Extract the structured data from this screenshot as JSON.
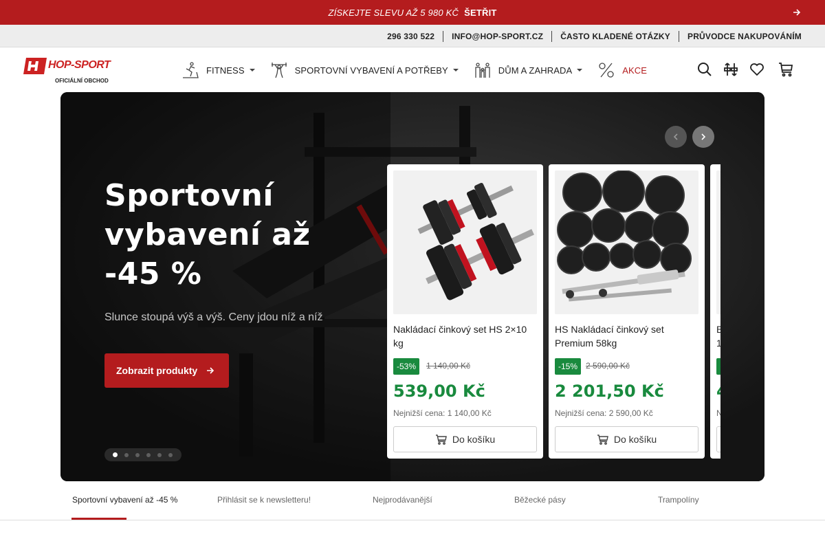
{
  "promo": {
    "text": "ZÍSKEJTE SLEVU AŽ 5 980 KČ",
    "cta": "ŠETŘIT",
    "arrow_icon": "arrow-right-icon"
  },
  "utility": {
    "phone": "296 330 522",
    "email": "INFO@HOP-SPORT.CZ",
    "faq": "ČASTO KLADENÉ OTÁZKY",
    "guide": "PRŮVODCE NAKUPOVÁNÍM"
  },
  "logo": {
    "brand": "HOP-SPORT",
    "subtitle": "OFICIÁLNÍ OBCHOD"
  },
  "nav": [
    {
      "label": "FITNESS",
      "icon": "treadmill-icon"
    },
    {
      "label": "SPORTOVNÍ VYBAVENÍ A POTŘEBY",
      "icon": "weightlifter-icon"
    },
    {
      "label": "DŮM A ZAHRADA",
      "icon": "family-icon"
    },
    {
      "label": "AKCE",
      "icon": "percent-icon"
    }
  ],
  "header_icons": [
    "search-icon",
    "compare-icon",
    "heart-icon",
    "cart-icon"
  ],
  "hero": {
    "title_line1": "Sportovní",
    "title_line2": "vybavení až",
    "title_line3": "-45 %",
    "lead": "Slunce stoupá výš a výš. Ceny jdou níž a níž",
    "button": "Zobrazit produkty",
    "slide_count": 6,
    "active_slide": 1
  },
  "products": [
    {
      "name": "Nakládací činkový set HS 2×10 kg",
      "discount": "-53%",
      "old_price": "1 140,00 Kč",
      "price": "539,00 Kč",
      "lowest": "Nejnižší cena: 1 140,00 Kč",
      "button": "Do košíku"
    },
    {
      "name": "HS Nakládací činkový set Premium 58kg",
      "discount": "-15%",
      "old_price": "2 590,00 Kč",
      "price": "2 201,50 Kč",
      "lowest": "Nejnižší cena: 2 590,00 Kč",
      "button": "Do košíku"
    },
    {
      "name": "B",
      "name2": "1",
      "price_fragment": "4",
      "lowest_fragment": "N"
    }
  ],
  "tabs": [
    "Sportovní vybavení až -45 %",
    "Přihlásit se k newsletteru!",
    "Nejprodávanější",
    "Běžecké pásy",
    "Trampolíny"
  ],
  "colors": {
    "brand_red": "#b41c1e",
    "price_green": "#198a3e"
  }
}
